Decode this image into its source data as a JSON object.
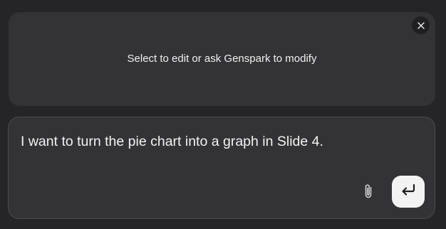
{
  "edit_panel": {
    "hint_text": "Select to edit or ask Genspark to modify",
    "close_icon": "close-icon"
  },
  "composer": {
    "input_value": "I want to turn the pie chart into a graph in Slide 4.",
    "attach_icon": "paperclip-icon",
    "send_icon": "enter-return-icon"
  },
  "colors": {
    "background": "#252527",
    "panel": "#333335",
    "send_button_bg": "#f3f3f3"
  }
}
